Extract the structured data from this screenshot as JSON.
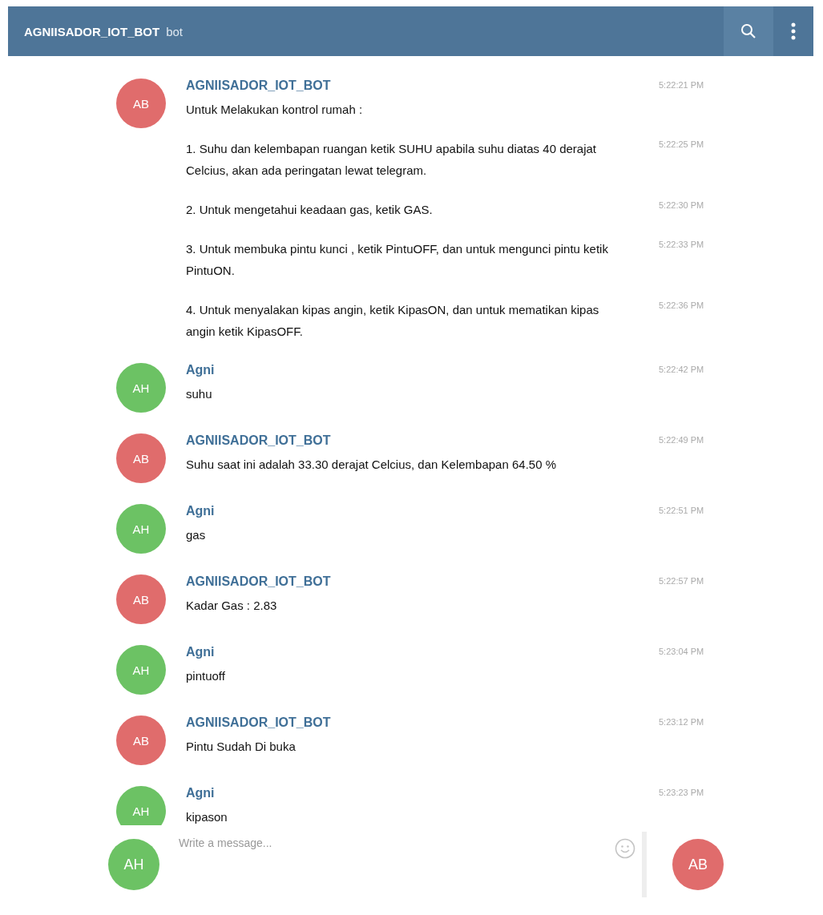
{
  "header": {
    "title": "AGNIISADOR_IOT_BOT",
    "subtitle": "bot"
  },
  "messages": [
    {
      "sender": "AGNIISADOR_IOT_BOT",
      "initials": "AB",
      "color": "#e06c6c",
      "items": [
        {
          "text": "Untuk Melakukan kontrol rumah :",
          "time": "5:22:21 PM"
        },
        {
          "text": "1. Suhu dan kelembapan ruangan ketik SUHU apabila suhu diatas 40 derajat Celcius, akan ada peringatan lewat telegram.",
          "time": "5:22:25 PM"
        },
        {
          "text": "2. Untuk mengetahui keadaan gas, ketik GAS.",
          "time": "5:22:30 PM"
        },
        {
          "text": "3. Untuk membuka pintu kunci , ketik PintuOFF, dan untuk mengunci pintu ketik PintuON.",
          "time": "5:22:33 PM"
        },
        {
          "text": "4. Untuk menyalakan kipas angin, ketik KipasON, dan untuk mematikan kipas angin ketik KipasOFF.",
          "time": "5:22:36 PM"
        }
      ]
    },
    {
      "sender": "Agni",
      "initials": "AH",
      "color": "#6cc264",
      "items": [
        {
          "text": "suhu",
          "time": "5:22:42 PM"
        }
      ]
    },
    {
      "sender": "AGNIISADOR_IOT_BOT",
      "initials": "AB",
      "color": "#e06c6c",
      "items": [
        {
          "text": "Suhu saat ini adalah 33.30 derajat Celcius, dan Kelembapan 64.50 %",
          "time": "5:22:49 PM"
        }
      ]
    },
    {
      "sender": "Agni",
      "initials": "AH",
      "color": "#6cc264",
      "items": [
        {
          "text": "gas",
          "time": "5:22:51 PM"
        }
      ]
    },
    {
      "sender": "AGNIISADOR_IOT_BOT",
      "initials": "AB",
      "color": "#e06c6c",
      "items": [
        {
          "text": "Kadar Gas : 2.83",
          "time": "5:22:57 PM"
        }
      ]
    },
    {
      "sender": "Agni",
      "initials": "AH",
      "color": "#6cc264",
      "items": [
        {
          "text": "pintuoff",
          "time": "5:23:04 PM"
        }
      ]
    },
    {
      "sender": "AGNIISADOR_IOT_BOT",
      "initials": "AB",
      "color": "#e06c6c",
      "items": [
        {
          "text": "Pintu Sudah Di buka",
          "time": "5:23:12 PM"
        }
      ]
    },
    {
      "sender": "Agni",
      "initials": "AH",
      "color": "#6cc264",
      "items": [
        {
          "text": "kipason",
          "time": "5:23:23 PM"
        }
      ]
    }
  ],
  "composer": {
    "placeholder": "Write a message...",
    "self": {
      "initials": "AH",
      "color": "#6cc264"
    },
    "peer": {
      "initials": "AB",
      "color": "#e06c6c"
    }
  }
}
